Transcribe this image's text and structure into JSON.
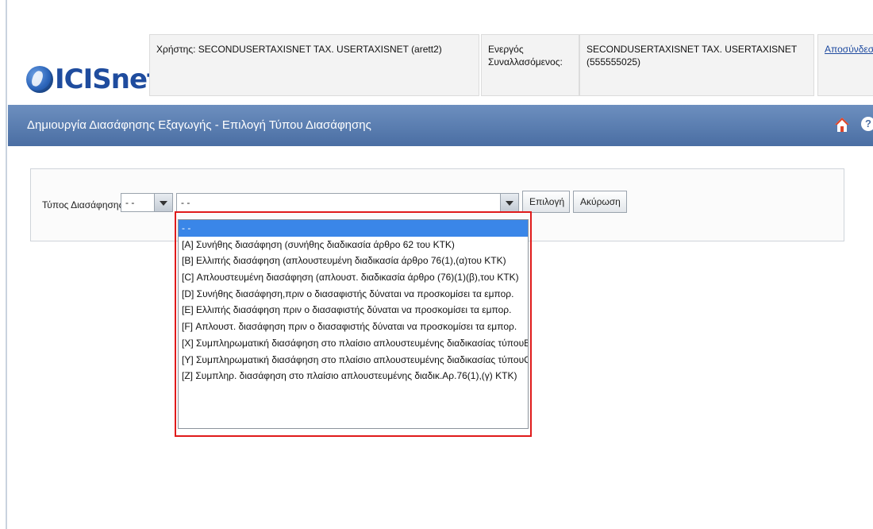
{
  "header": {
    "logo_text": "ICISnet",
    "user_line": "Χρήστης: SECONDUSERTAXISNET TAX. USERTAXISNET (arett2)",
    "trader_label": "Ενεργός Συναλλασόμενος:",
    "trader_value": "SECONDUSERTAXISNET TAX. USERTAXISNET (555555025)",
    "logout_link": "Αποσύνδεση"
  },
  "titlebar": {
    "title": "Δημιουργία Διασάφησης Εξαγωγής - Επιλογή Τύπου Διασάφησης",
    "home_icon": "home-icon",
    "help_icon": "help-icon"
  },
  "form": {
    "label": "Τύπος Διασάφησης",
    "small_select_value": "- -",
    "main_select_value": "- -",
    "select_button": "Επιλογή",
    "cancel_button": "Ακύρωση"
  },
  "dropdown": {
    "options": [
      "- -",
      "[A] Συνήθης διασάφηση (συνήθης διαδικασία άρθρο 62 του ΚΤΚ)",
      "[B] Ελλιπής διασάφηση (απλουστευμένη διαδικασία άρθρο 76(1),(α)του ΚΤΚ)",
      "[C] Απλουστευμένη διασάφηση (απλουστ. διαδικασία άρθρο (76)(1)(β),του ΚΤΚ)",
      "[D] Συνήθης διασάφηση,πριν ο διασαφιστής δύναται να προσκομίσει τα εμπορ.",
      "[E] Ελλιπής διασάφηση πριν ο διασαφιστής δύναται να προσκομίσει τα εμπορ.",
      "[F] Απλουστ. διασάφηση πριν ο διασαφιστής δύναται να προσκομίσει τα εμπορ.",
      "[X] Συμπληρωματική διασάφηση στο πλαίσιο απλουστευμένης διαδικασίας τύπουB",
      "[Y] Συμπληρωματική διασάφηση στο πλαίσιο απλουστευμένης διαδικασίας τύπουC",
      "[Z] Συμπληρ. διασάφηση στο πλαίσιο απλουστευμένης διαδικ.Αρ.76(1),(γ) ΚΤΚ)"
    ],
    "selected_index": 0
  },
  "colors": {
    "titlebar": "#4a6ea3",
    "selection": "#3a86e8",
    "highlight": "#e01b1b"
  }
}
